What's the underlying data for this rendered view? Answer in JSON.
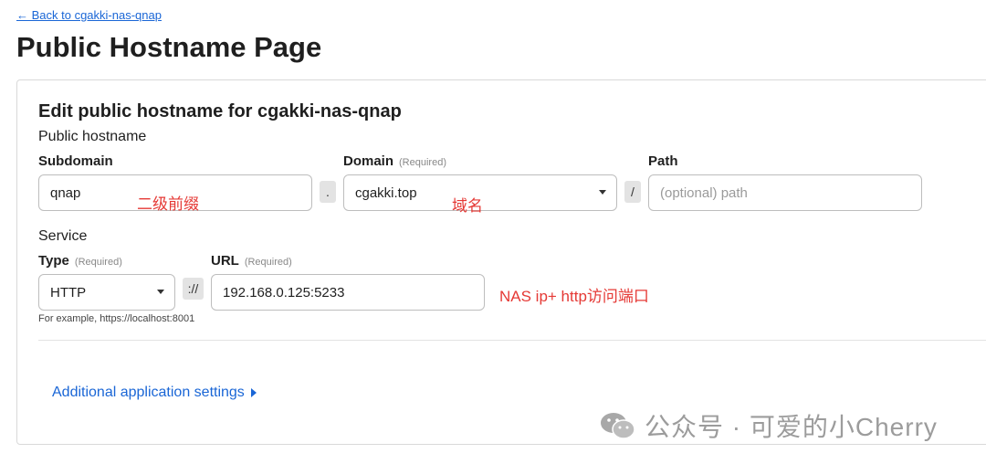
{
  "nav": {
    "back_label": "← Back to cgakki-nas-qnap"
  },
  "page": {
    "title": "Public Hostname Page"
  },
  "form": {
    "title": "Edit public hostname for cgakki-nas-qnap",
    "public_hostname_label": "Public hostname",
    "subdomain": {
      "label": "Subdomain",
      "value": "qnap"
    },
    "dot_separator": ".",
    "domain": {
      "label": "Domain",
      "required": "(Required)",
      "value": "cgakki.top"
    },
    "slash_separator": "/",
    "path": {
      "label": "Path",
      "placeholder": "(optional) path"
    },
    "service_label": "Service",
    "type": {
      "label": "Type",
      "required": "(Required)",
      "value": "HTTP"
    },
    "scheme_separator": "://",
    "url": {
      "label": "URL",
      "required": "(Required)",
      "value": "192.168.0.125:5233"
    },
    "example_hint": "For example, https://localhost:8001",
    "additional_settings_label": "Additional application settings"
  },
  "annotations": {
    "subdomain_note": "二级前缀",
    "domain_note": "域名",
    "url_note": "NAS ip+ http访问端口"
  },
  "watermark": {
    "text": "公众号 · 可爱的小Cherry"
  },
  "colors": {
    "link": "#1a66d6",
    "annotation": "#e53935",
    "border": "#bdbdbd"
  }
}
